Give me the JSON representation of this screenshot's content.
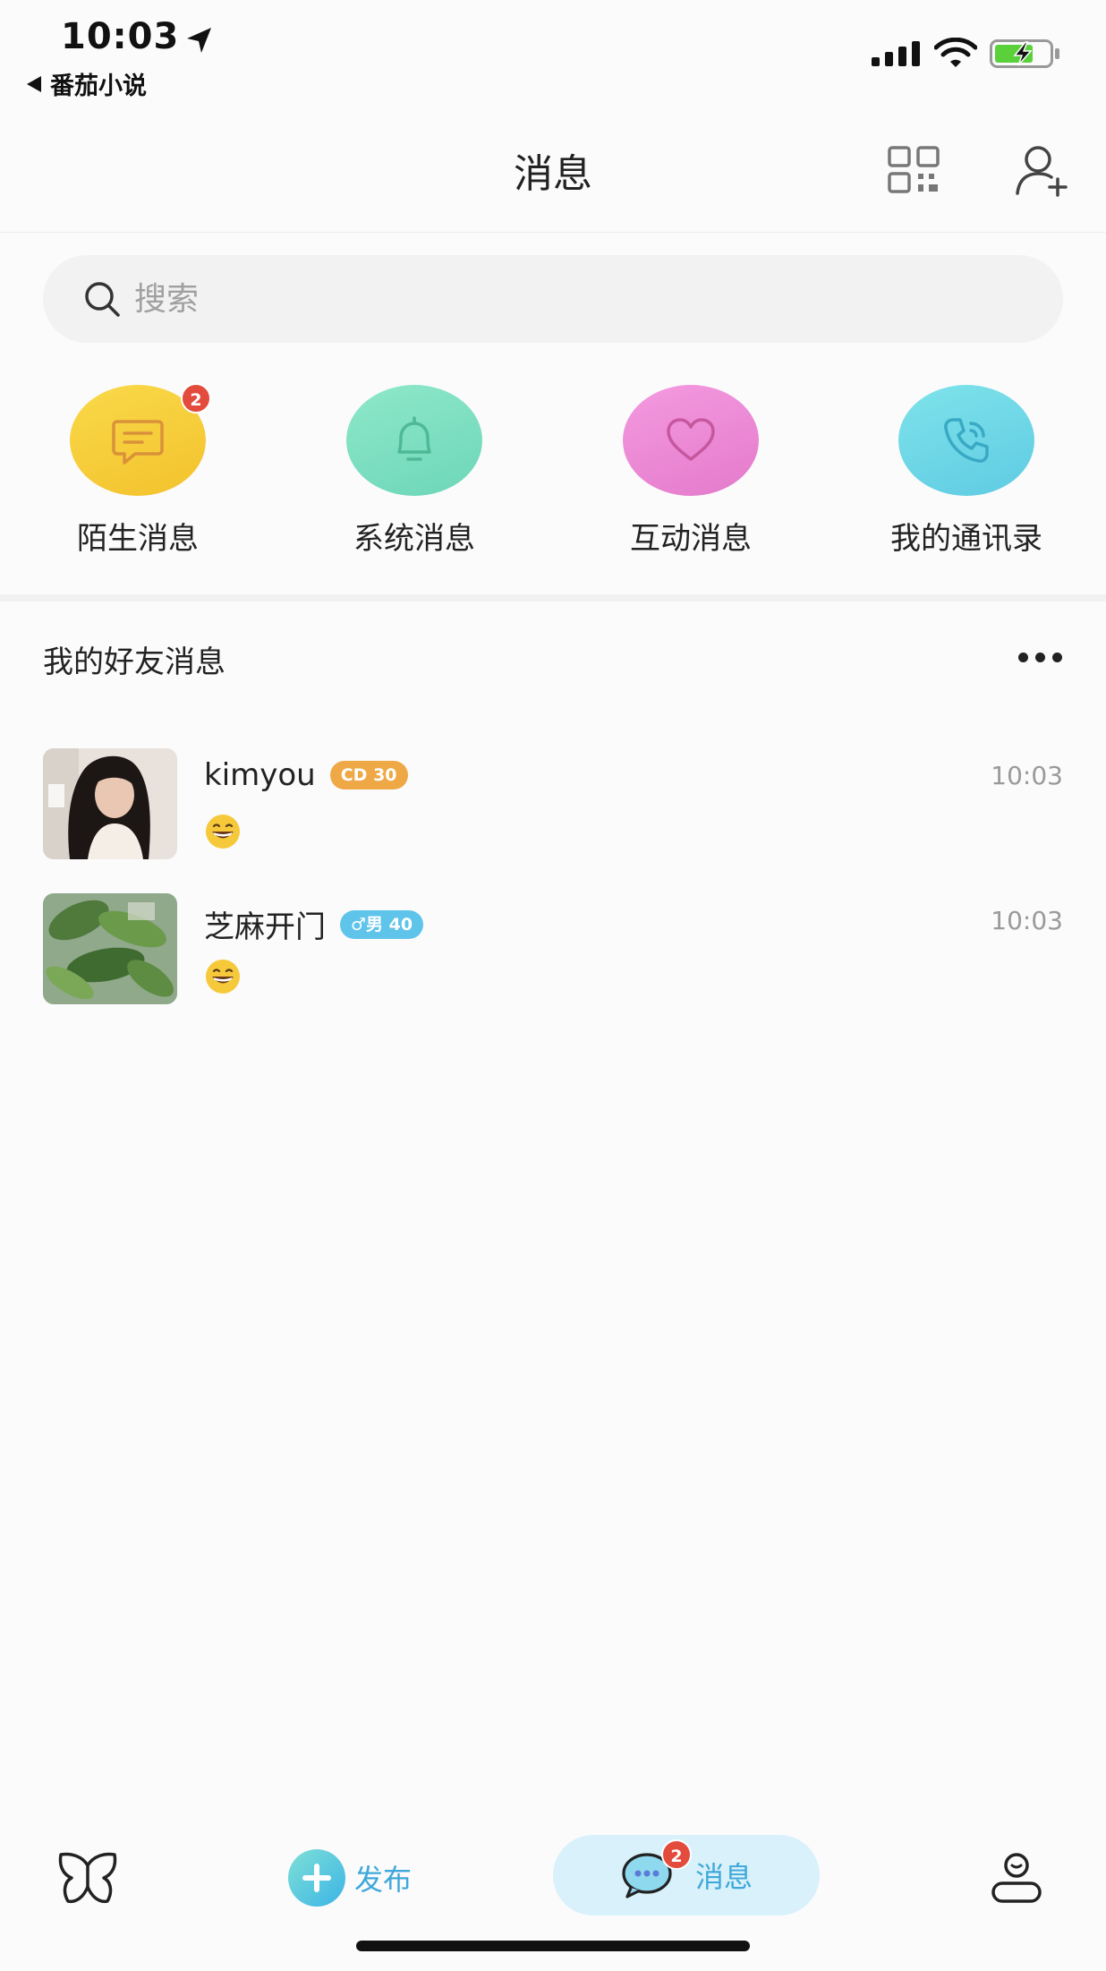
{
  "status_bar": {
    "time": "10:03",
    "back_app": "番茄小说",
    "battery_color": "#5ad13a"
  },
  "nav": {
    "title": "消息",
    "qr_icon": "qr-code-icon",
    "add_user_icon": "add-user-icon"
  },
  "search": {
    "placeholder": "搜索"
  },
  "quick_entries": [
    {
      "label": "陌生消息",
      "icon": "chat-bubble-icon",
      "color": "#f6cf3c",
      "badge": "2"
    },
    {
      "label": "系统消息",
      "icon": "bell-icon",
      "color": "#7fe0c2"
    },
    {
      "label": "互动消息",
      "icon": "heart-icon",
      "color": "#ef8ad6"
    },
    {
      "label": "我的通讯录",
      "icon": "phone-icon",
      "color": "#6fd3e6"
    }
  ],
  "friends": {
    "section_title": "我的好友消息",
    "chats": [
      {
        "name": "kimyou",
        "tag": "CD 30",
        "time": "10:03",
        "preview": "grinning-face-emoji"
      },
      {
        "name": "芝麻开门",
        "tag": "♂男 40",
        "time": "10:03",
        "preview": "grinning-face-emoji"
      }
    ]
  },
  "tab_bar": {
    "publish_label": "发布",
    "messages_label": "消息",
    "messages_badge": "2",
    "accent": "#3fa8da"
  }
}
